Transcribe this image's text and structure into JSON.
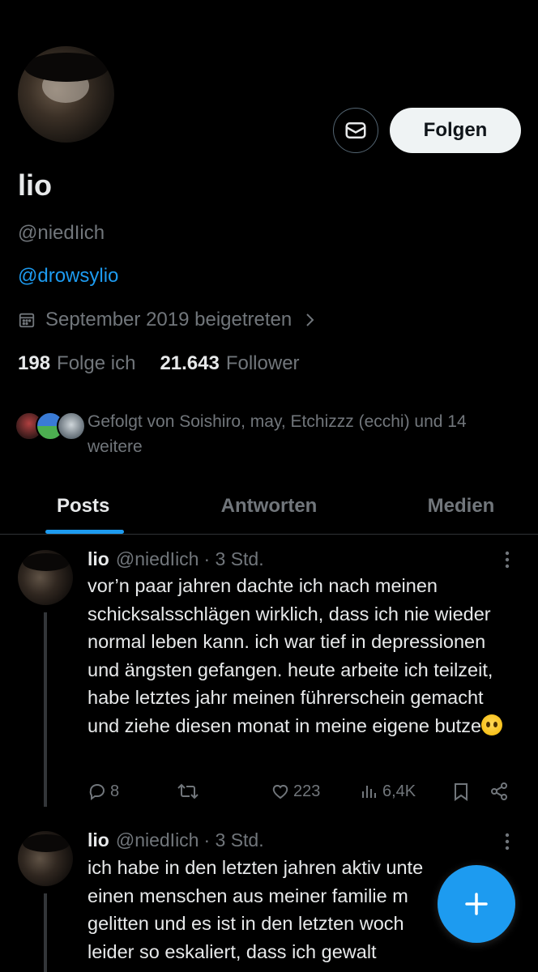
{
  "profile": {
    "name": "lio",
    "handle": "@niedIich",
    "bio_link": "@drowsylio",
    "joined": "September 2019 beigetreten",
    "following_count": "198",
    "following_label": "Folge ich",
    "followers_count": "21.643",
    "followers_label": "Follower",
    "followed_by": "Gefolgt von Soishiro, may, Etchizzz (ecchi) und 14 weitere"
  },
  "actions": {
    "follow_label": "Folgen"
  },
  "tabs": [
    {
      "label": "Posts",
      "active": true
    },
    {
      "label": "Antworten",
      "active": false
    },
    {
      "label": "Medien",
      "active": false
    }
  ],
  "posts": [
    {
      "name": "lio",
      "handle": "@niedIich",
      "time": "· 3 Std.",
      "text": "vor’n paar jahren dachte ich nach meinen schicksalsschlägen wirklich, dass ich nie wieder normal leben kann. ich war tief in depressionen und ängsten gefangen. heute arbeite ich teilzeit, habe letztes jahr meinen führerschein gemacht und ziehe diesen monat in meine eigene butze",
      "emoji": "pleading-face",
      "replies": "8",
      "reposts": "",
      "likes": "223",
      "views": "6,4K"
    },
    {
      "name": "lio",
      "handle": "@niedIich",
      "time": "· 3 Std.",
      "text": "ich habe in den letzten jahren aktiv unte\neinen menschen aus meiner familie m\ngelitten und es ist in den letzten woch\nleider so eskaliert, dass ich gewalt"
    }
  ],
  "colors": {
    "accent": "#1d9bf0",
    "background": "#000000",
    "muted": "#71767b",
    "text": "#e7e9ea"
  }
}
